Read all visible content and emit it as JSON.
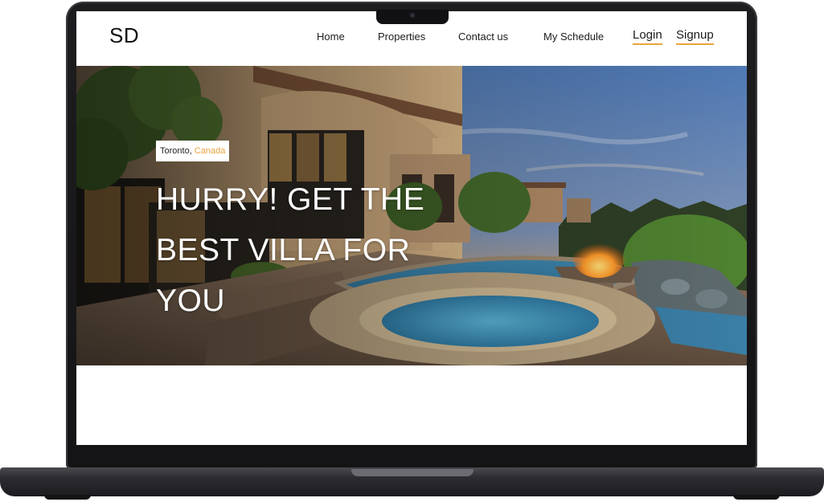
{
  "nav": {
    "logo": "SD",
    "links": [
      "Home",
      "Properties",
      "Contact us",
      "My Schedule"
    ],
    "login": "Login",
    "signup": "Signup"
  },
  "hero": {
    "city": "Toronto,",
    "country": "Canada",
    "heading": "HURRY! GET THE BEST VILLA FOR YOU"
  },
  "colors": {
    "accent": "#e8a33a",
    "device": "#1d1d20"
  }
}
